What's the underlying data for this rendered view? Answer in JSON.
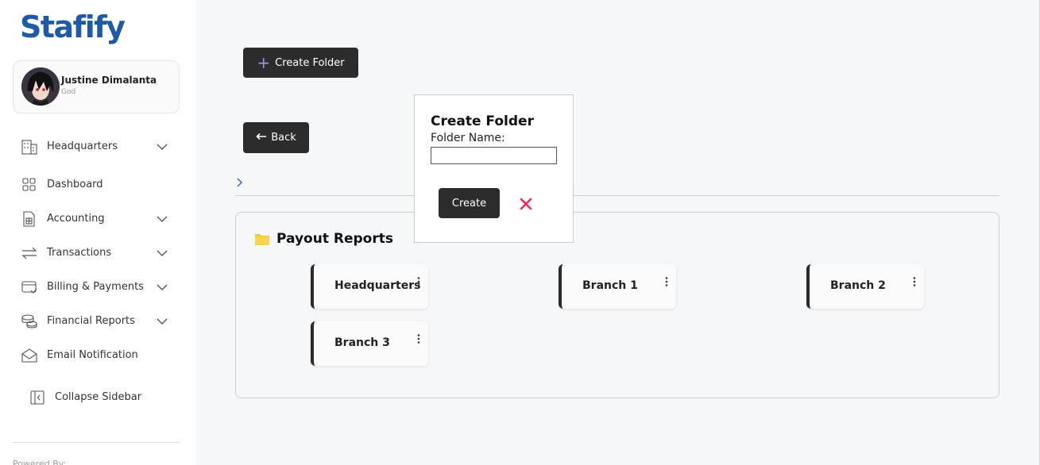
{
  "brand": {
    "logo_text": "Stafify",
    "logo_color": "#1f5aa6"
  },
  "profile": {
    "name": "Justine Dimalanta",
    "role": "God"
  },
  "sidebar": {
    "items": [
      {
        "label": "Headquarters",
        "icon": "building-icon",
        "has_chevron": true
      },
      {
        "label": "Dashboard",
        "icon": "grid-icon",
        "has_chevron": false
      },
      {
        "label": "Accounting",
        "icon": "calculator-icon",
        "has_chevron": true
      },
      {
        "label": "Transactions",
        "icon": "arrows-swap-icon",
        "has_chevron": true
      },
      {
        "label": "Billing & Payments",
        "icon": "card-icon",
        "has_chevron": true
      },
      {
        "label": "Financial Reports",
        "icon": "coins-icon",
        "has_chevron": true
      },
      {
        "label": "Email Notification",
        "icon": "mail-icon",
        "has_chevron": false
      }
    ],
    "collapse_label": "Collapse Sidebar",
    "powered_by": "Powered By:"
  },
  "toolbar": {
    "create_folder_label": "Create Folder",
    "back_label": "Back"
  },
  "panel": {
    "title": "Payout Reports",
    "folders": [
      {
        "label": "Headquarters"
      },
      {
        "label": "Branch 1"
      },
      {
        "label": "Branch 2"
      },
      {
        "label": "Branch 3"
      }
    ]
  },
  "modal": {
    "title": "Create Folder",
    "field_label": "Folder Name:",
    "field_value": "",
    "create_label": "Create",
    "close_color": "#e8305a"
  },
  "colors": {
    "accent_dark": "#2c2c2c",
    "folder_yellow": "#f5c53a",
    "plus_purple": "#9b94d8"
  }
}
